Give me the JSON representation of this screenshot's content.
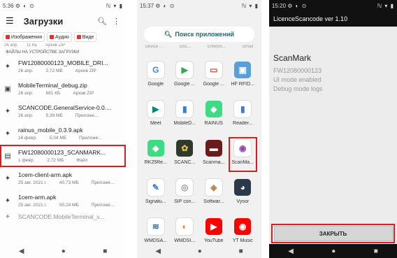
{
  "phone1": {
    "status": {
      "time": "5:36",
      "icons": "⚙ ◐ ⊙",
      "right": "ℕ ▾ ▮"
    },
    "title": "Загрузки",
    "chips": [
      {
        "label": "Изображения"
      },
      {
        "label": "Аудио"
      },
      {
        "label": "Виде"
      }
    ],
    "partial_top": {
      "date": "26 апр.",
      "size": "11 КБ",
      "type": "Архив ZIP"
    },
    "section": "Файлы на устройстве Загрузки",
    "files": [
      {
        "name": "FW12080000123_MOBILE_DRI...",
        "date": "26 апр.",
        "size": "2,72 МБ",
        "type": "Архив ZIP"
      },
      {
        "name": "MobileTerminal_debug.zip",
        "date": "26 апр.",
        "size": "681 КБ",
        "type": "Архив ZIP"
      },
      {
        "name": "SCANCODE.GeneralService-0.0....",
        "date": "26 апр.",
        "size": "5,39 МБ",
        "type": "Приложе..."
      },
      {
        "name": "rainus_mobile_0.3.9.apk",
        "date": "16 февр.",
        "size": "5,04 МБ",
        "type": "Приложе..."
      },
      {
        "name": "FW12080000123_SCANMARK...",
        "date": "1 февр.",
        "size": "2,72 МБ",
        "type": "Файл"
      },
      {
        "name": "1cem-client-arm.apk",
        "date": "25 авг. 2021 г.",
        "size": "40,73 МБ",
        "type": "Приложе..."
      },
      {
        "name": "1cem-arm.apk",
        "date": "25 авг. 2021 г.",
        "size": "50,24 МБ",
        "type": "Приложе..."
      }
    ],
    "partial_bottom": "SCANCODE.MobileTerminal_v..."
  },
  "phone2": {
    "status": {
      "time": "15:37",
      "icons": "⚙ ◐ ⊙",
      "right": "ℕ ▾ ▮"
    },
    "search": "Поиск приложений",
    "cut_labels": [
      "Device ...",
      "Disc...",
      "Enterpri...",
      "Gmail"
    ],
    "apps": [
      {
        "label": "Google",
        "icon": "G",
        "color": "#ffffff",
        "fg": "#4285f4"
      },
      {
        "label": "Google ...",
        "icon": "▶",
        "color": "#ffffff",
        "fg": "#34a853"
      },
      {
        "label": "Google ...",
        "icon": "▭",
        "color": "#ffffff",
        "fg": "#ea4335"
      },
      {
        "label": "HF RFID...",
        "icon": "▣",
        "color": "#5aa0d8",
        "fg": "#ffffff"
      },
      {
        "label": "Meet",
        "icon": "▶",
        "color": "#ffffff",
        "fg": "#00897b"
      },
      {
        "label": "MobileD...",
        "icon": "▮",
        "color": "#ffffff",
        "fg": "#3a7bd5"
      },
      {
        "label": "RAINUS",
        "icon": "◆",
        "color": "#3ddc84",
        "fg": "#ffffff"
      },
      {
        "label": "Reader...",
        "icon": "▮",
        "color": "#ffffff",
        "fg": "#3a7bd5"
      },
      {
        "label": "RK25Re...",
        "icon": "◆",
        "color": "#3ddc84",
        "fg": "#ffffff"
      },
      {
        "label": "SCANC...",
        "icon": "✿",
        "color": "#2f3b2a",
        "fg": "#e6b94d"
      },
      {
        "label": "Scanma...",
        "icon": "▬",
        "color": "#6b1b1b",
        "fg": "#ffffff"
      },
      {
        "label": "ScanMa...",
        "icon": "◉",
        "color": "#ffffff",
        "fg": "#8e44ad"
      },
      {
        "label": "Signatu...",
        "icon": "✎",
        "color": "#ffffff",
        "fg": "#3a7bd5"
      },
      {
        "label": "SIP con...",
        "icon": "◎",
        "color": "#ffffff",
        "fg": "#999999"
      },
      {
        "label": "Softwar...",
        "icon": "◈",
        "color": "#ffffff",
        "fg": "#c08040"
      },
      {
        "label": "Vysor",
        "icon": "◕",
        "color": "#2b3a4a",
        "fg": "#ffffff"
      },
      {
        "label": "WMDSA...",
        "icon": "≋",
        "color": "#ffffff",
        "fg": "#2a6db0"
      },
      {
        "label": "WMDSI...",
        "icon": "◐",
        "color": "#ffffff",
        "fg": "#e08a1e"
      },
      {
        "label": "YouTube",
        "icon": "▶",
        "color": "#ff0000",
        "fg": "#ffffff"
      },
      {
        "label": "YT Music",
        "icon": "◉",
        "color": "#ff0000",
        "fg": "#ffffff"
      }
    ]
  },
  "phone3": {
    "status": {
      "time": "15:20",
      "icons": "⚙ ◐ ⊙",
      "right": "ℕ ▾ ▮"
    },
    "title": "LicenceScancode ver 1.10",
    "heading": "ScanMark",
    "lines": [
      "FW12080000123",
      "UI mode enabled",
      "Debug mode logs"
    ],
    "close": "ЗАКРЫТЬ"
  },
  "nav": {
    "back": "◀",
    "home": "●",
    "recents": "■"
  },
  "colors": {
    "highlight": "#d81e1e"
  }
}
